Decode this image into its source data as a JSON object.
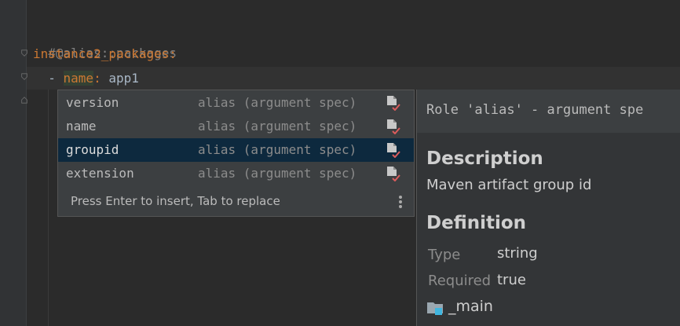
{
  "editor": {
    "lines": [
      {
        "comment": "#@alias::packages"
      },
      {
        "key": "instance2_packages",
        "colon": ":"
      },
      {
        "dash": "  - ",
        "key": "name",
        "colon": ": ",
        "value": "app1"
      }
    ]
  },
  "completion": {
    "items": [
      {
        "label": "version",
        "type": "alias (argument spec)"
      },
      {
        "label": "name",
        "type": "alias (argument spec)"
      },
      {
        "label": "groupid",
        "type": "alias (argument spec)",
        "selected": true
      },
      {
        "label": "extension",
        "type": "alias (argument spec)"
      }
    ],
    "hint": "Press Enter to insert, Tab to replace"
  },
  "doc": {
    "title": "Role 'alias' - argument spe",
    "description_heading": "Description",
    "description": "Maven artifact group id",
    "definition_heading": "Definition",
    "type_label": "Type",
    "type_value": "string",
    "required_label": "Required",
    "required_value": "true",
    "module": "_main"
  },
  "colors": {
    "background": "#2b2b2b",
    "selection": "#0d293e",
    "keyword": "#cc7832",
    "comment": "#808080"
  }
}
